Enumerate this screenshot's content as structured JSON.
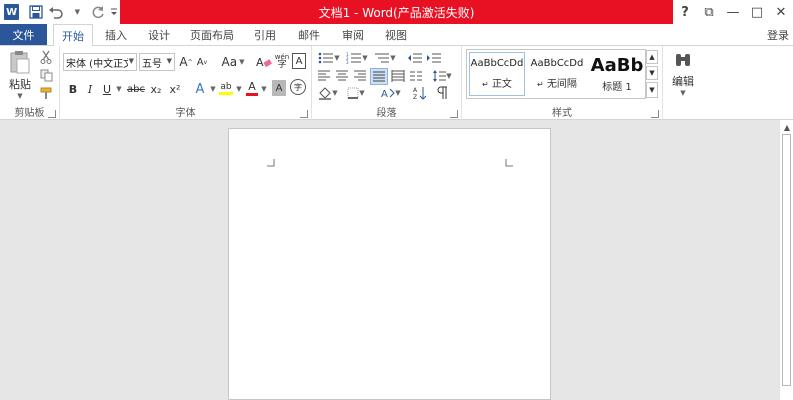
{
  "titlebar": {
    "title": "文档1 - Word(产品激活失败)",
    "logo": "W",
    "qat": [
      {
        "icon": "save-icon"
      },
      {
        "icon": "undo-icon"
      },
      {
        "icon": "redo-icon"
      },
      {
        "icon": "customize-qat-icon"
      }
    ],
    "controls": {
      "help": "?",
      "restore_ribbon": "⧉",
      "minimize": "—",
      "maximize": "□",
      "close": "✕"
    },
    "accent": "#e81123"
  },
  "tabs": {
    "file": "文件",
    "items": [
      "开始",
      "插入",
      "设计",
      "页面布局",
      "引用",
      "邮件",
      "审阅",
      "视图"
    ],
    "active": "开始",
    "login": "登录",
    "accent": "#2b579a"
  },
  "ribbon": {
    "clipboard": {
      "label": "剪贴板",
      "paste": "粘贴"
    },
    "font": {
      "label": "字体",
      "font_name": "宋体 (中文正文",
      "font_size": "五号",
      "bold": "B",
      "italic": "I",
      "underline": "U",
      "strike": "abc",
      "subscript": "x₂",
      "superscript": "x²",
      "case": "Aa",
      "grow": "A",
      "shrink": "A",
      "clear_format": "A",
      "font_color": "A",
      "text_effect": "A",
      "highlight": "ab",
      "char_shading": "A",
      "enclose": "字",
      "phonetic": "wén",
      "border_char": "A"
    },
    "paragraph": {
      "label": "段落"
    },
    "styles": {
      "label": "样式",
      "items": [
        {
          "preview": "AaBbCcDd",
          "name": "正文",
          "marker": "↵"
        },
        {
          "preview": "AaBbCcDd",
          "name": "无间隔",
          "marker": "↵"
        },
        {
          "preview": "AaBb",
          "name": "标题 1",
          "marker": ""
        }
      ]
    },
    "editing": {
      "label": "编辑"
    }
  }
}
